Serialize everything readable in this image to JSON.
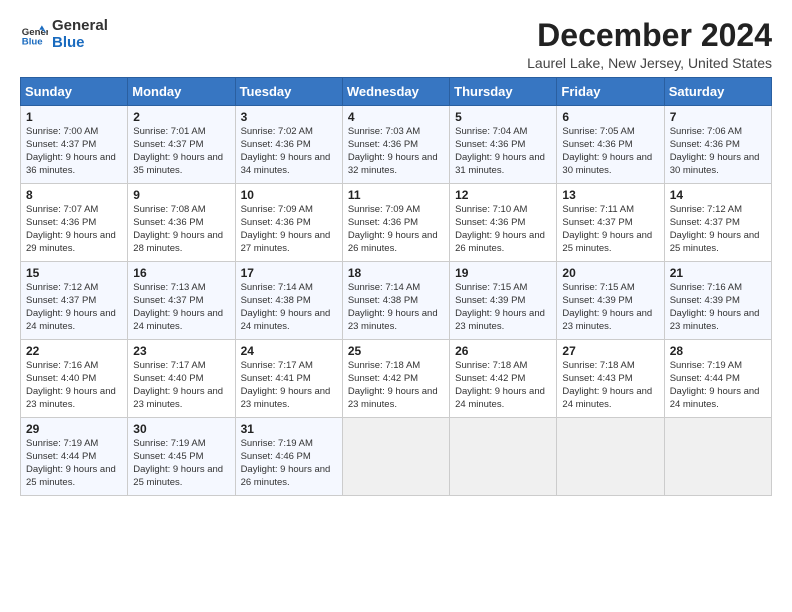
{
  "logo": {
    "text_general": "General",
    "text_blue": "Blue"
  },
  "title": "December 2024",
  "subtitle": "Laurel Lake, New Jersey, United States",
  "header": {
    "colors": {
      "accent": "#3776c2"
    }
  },
  "weekdays": [
    "Sunday",
    "Monday",
    "Tuesday",
    "Wednesday",
    "Thursday",
    "Friday",
    "Saturday"
  ],
  "weeks": [
    [
      {
        "day": "1",
        "sunrise": "7:00 AM",
        "sunset": "4:37 PM",
        "daylight": "9 hours and 36 minutes."
      },
      {
        "day": "2",
        "sunrise": "7:01 AM",
        "sunset": "4:37 PM",
        "daylight": "9 hours and 35 minutes."
      },
      {
        "day": "3",
        "sunrise": "7:02 AM",
        "sunset": "4:36 PM",
        "daylight": "9 hours and 34 minutes."
      },
      {
        "day": "4",
        "sunrise": "7:03 AM",
        "sunset": "4:36 PM",
        "daylight": "9 hours and 32 minutes."
      },
      {
        "day": "5",
        "sunrise": "7:04 AM",
        "sunset": "4:36 PM",
        "daylight": "9 hours and 31 minutes."
      },
      {
        "day": "6",
        "sunrise": "7:05 AM",
        "sunset": "4:36 PM",
        "daylight": "9 hours and 30 minutes."
      },
      {
        "day": "7",
        "sunrise": "7:06 AM",
        "sunset": "4:36 PM",
        "daylight": "9 hours and 30 minutes."
      }
    ],
    [
      {
        "day": "8",
        "sunrise": "7:07 AM",
        "sunset": "4:36 PM",
        "daylight": "9 hours and 29 minutes."
      },
      {
        "day": "9",
        "sunrise": "7:08 AM",
        "sunset": "4:36 PM",
        "daylight": "9 hours and 28 minutes."
      },
      {
        "day": "10",
        "sunrise": "7:09 AM",
        "sunset": "4:36 PM",
        "daylight": "9 hours and 27 minutes."
      },
      {
        "day": "11",
        "sunrise": "7:09 AM",
        "sunset": "4:36 PM",
        "daylight": "9 hours and 26 minutes."
      },
      {
        "day": "12",
        "sunrise": "7:10 AM",
        "sunset": "4:36 PM",
        "daylight": "9 hours and 26 minutes."
      },
      {
        "day": "13",
        "sunrise": "7:11 AM",
        "sunset": "4:37 PM",
        "daylight": "9 hours and 25 minutes."
      },
      {
        "day": "14",
        "sunrise": "7:12 AM",
        "sunset": "4:37 PM",
        "daylight": "9 hours and 25 minutes."
      }
    ],
    [
      {
        "day": "15",
        "sunrise": "7:12 AM",
        "sunset": "4:37 PM",
        "daylight": "9 hours and 24 minutes."
      },
      {
        "day": "16",
        "sunrise": "7:13 AM",
        "sunset": "4:37 PM",
        "daylight": "9 hours and 24 minutes."
      },
      {
        "day": "17",
        "sunrise": "7:14 AM",
        "sunset": "4:38 PM",
        "daylight": "9 hours and 24 minutes."
      },
      {
        "day": "18",
        "sunrise": "7:14 AM",
        "sunset": "4:38 PM",
        "daylight": "9 hours and 23 minutes."
      },
      {
        "day": "19",
        "sunrise": "7:15 AM",
        "sunset": "4:39 PM",
        "daylight": "9 hours and 23 minutes."
      },
      {
        "day": "20",
        "sunrise": "7:15 AM",
        "sunset": "4:39 PM",
        "daylight": "9 hours and 23 minutes."
      },
      {
        "day": "21",
        "sunrise": "7:16 AM",
        "sunset": "4:39 PM",
        "daylight": "9 hours and 23 minutes."
      }
    ],
    [
      {
        "day": "22",
        "sunrise": "7:16 AM",
        "sunset": "4:40 PM",
        "daylight": "9 hours and 23 minutes."
      },
      {
        "day": "23",
        "sunrise": "7:17 AM",
        "sunset": "4:40 PM",
        "daylight": "9 hours and 23 minutes."
      },
      {
        "day": "24",
        "sunrise": "7:17 AM",
        "sunset": "4:41 PM",
        "daylight": "9 hours and 23 minutes."
      },
      {
        "day": "25",
        "sunrise": "7:18 AM",
        "sunset": "4:42 PM",
        "daylight": "9 hours and 23 minutes."
      },
      {
        "day": "26",
        "sunrise": "7:18 AM",
        "sunset": "4:42 PM",
        "daylight": "9 hours and 24 minutes."
      },
      {
        "day": "27",
        "sunrise": "7:18 AM",
        "sunset": "4:43 PM",
        "daylight": "9 hours and 24 minutes."
      },
      {
        "day": "28",
        "sunrise": "7:19 AM",
        "sunset": "4:44 PM",
        "daylight": "9 hours and 24 minutes."
      }
    ],
    [
      {
        "day": "29",
        "sunrise": "7:19 AM",
        "sunset": "4:44 PM",
        "daylight": "9 hours and 25 minutes."
      },
      {
        "day": "30",
        "sunrise": "7:19 AM",
        "sunset": "4:45 PM",
        "daylight": "9 hours and 25 minutes."
      },
      {
        "day": "31",
        "sunrise": "7:19 AM",
        "sunset": "4:46 PM",
        "daylight": "9 hours and 26 minutes."
      },
      null,
      null,
      null,
      null
    ]
  ]
}
